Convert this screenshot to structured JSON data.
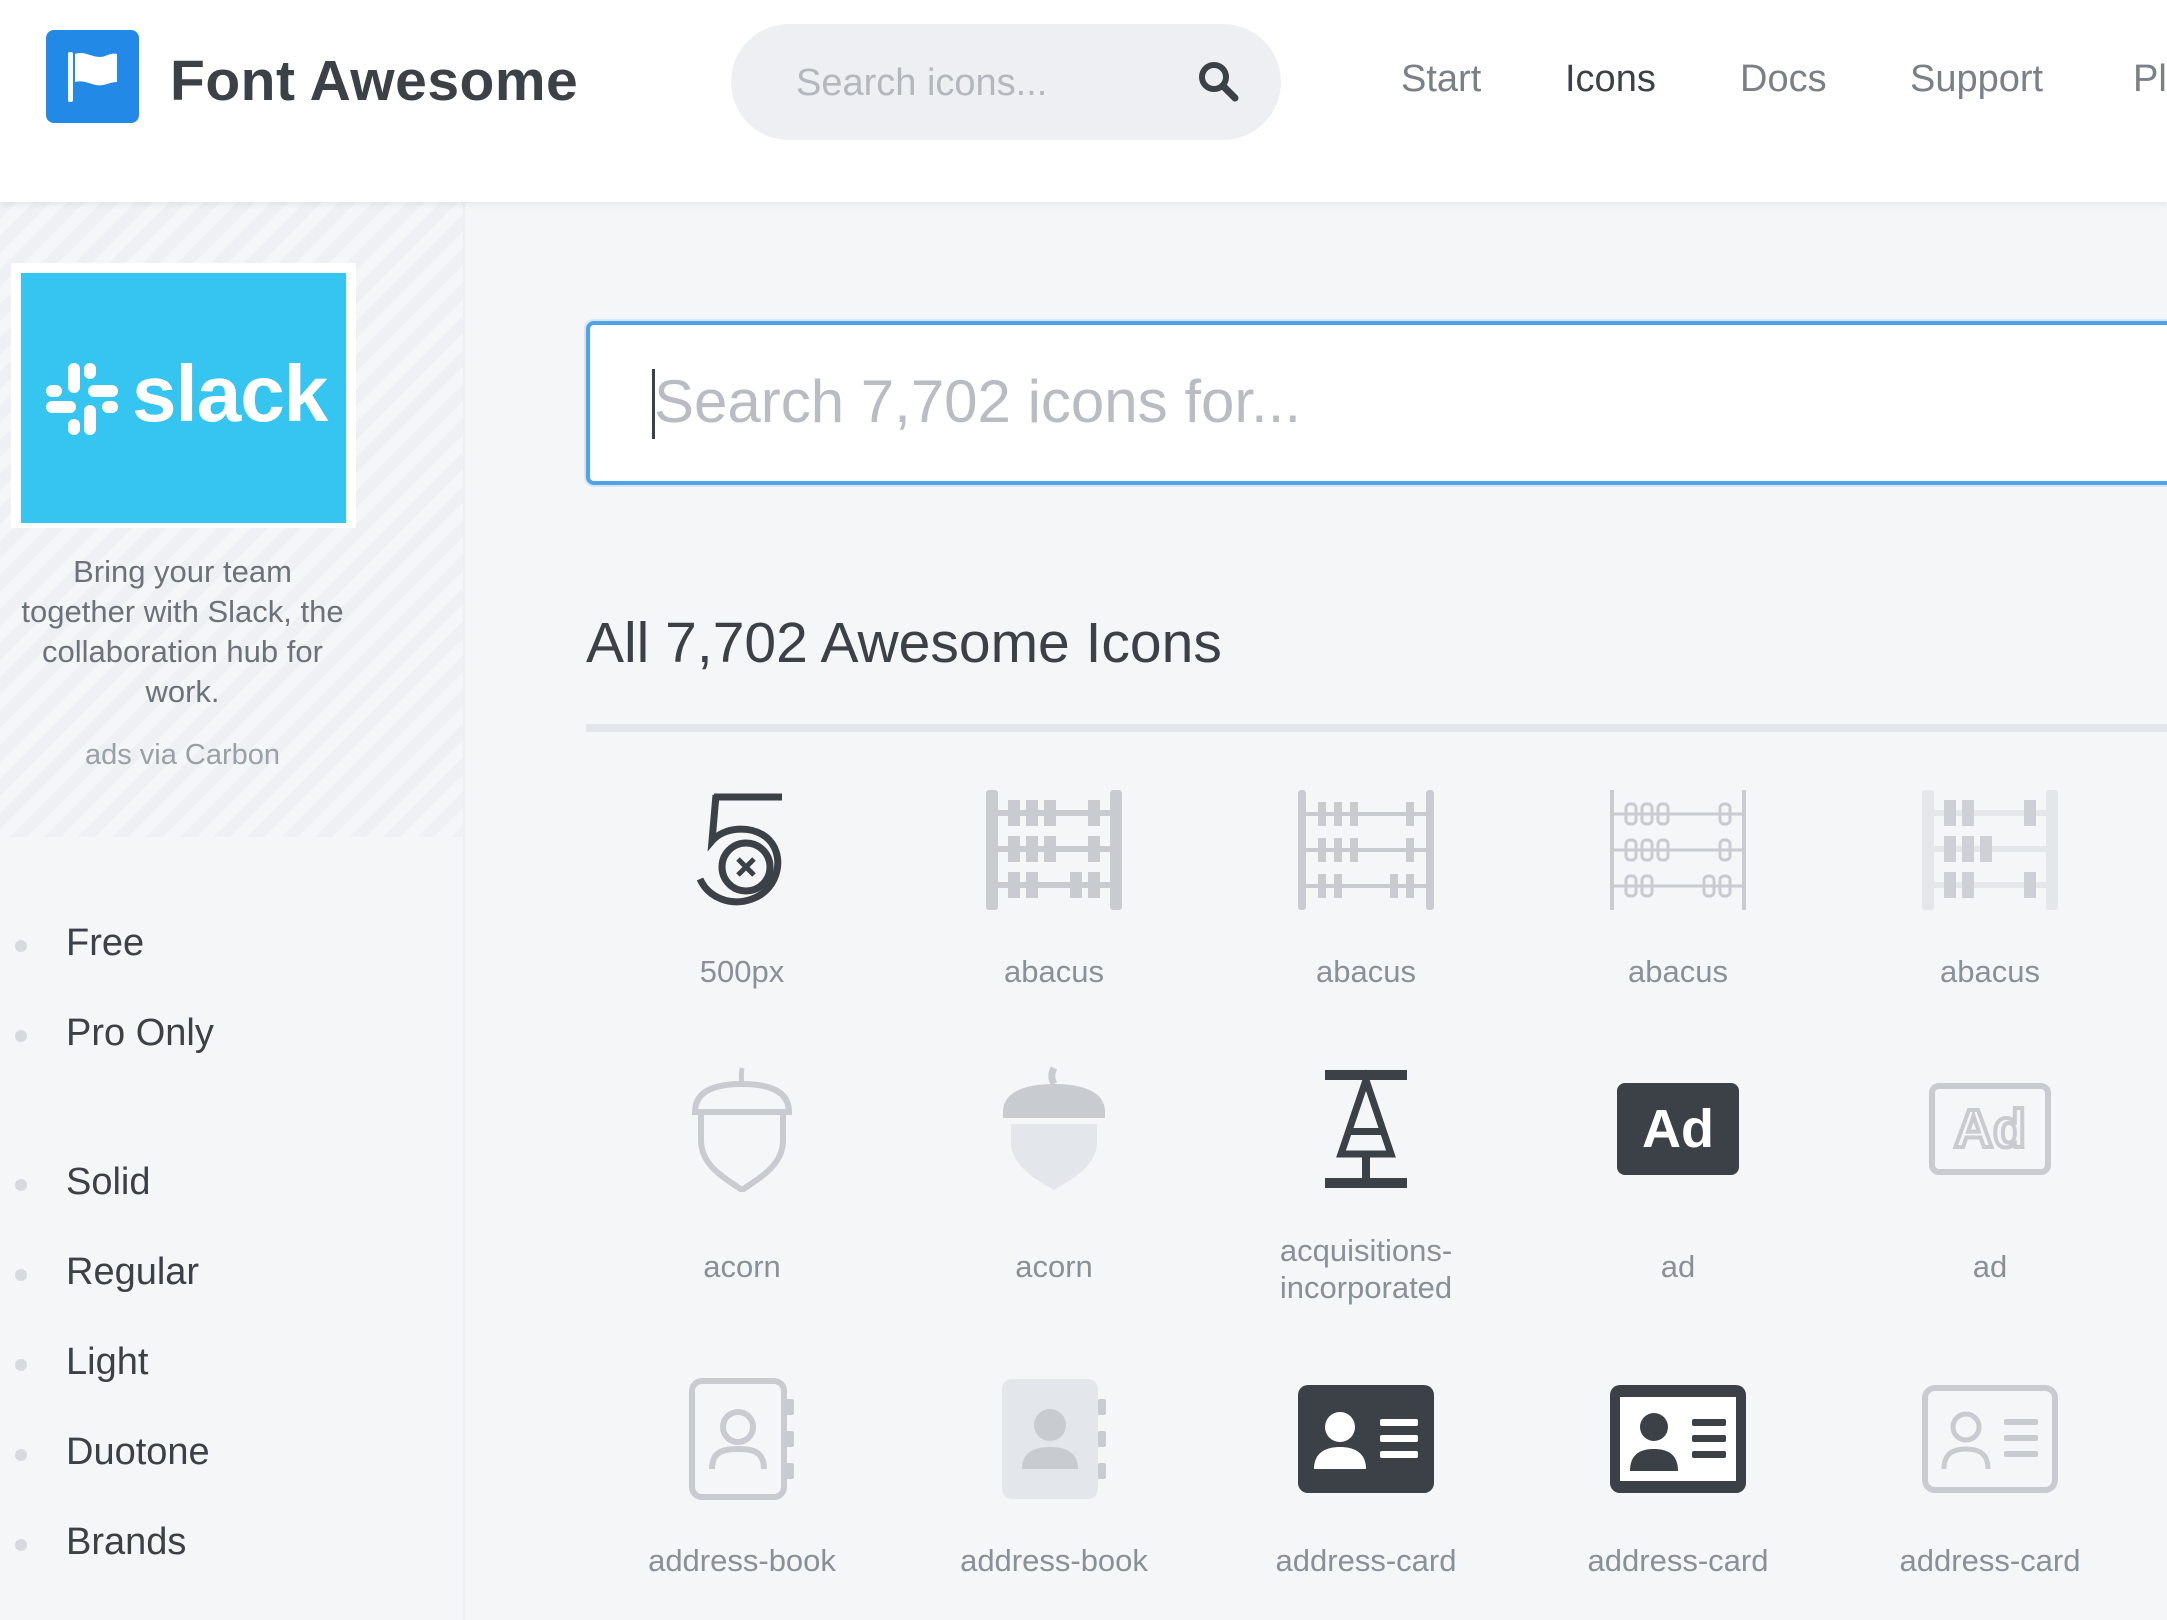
{
  "header": {
    "brand": "Font Awesome",
    "search_placeholder": "Search icons...",
    "nav": [
      "Start",
      "Icons",
      "Docs",
      "Support",
      "Pl"
    ],
    "active_nav": "Icons"
  },
  "sidebar": {
    "ad": {
      "image_text": "slack",
      "text": "Bring your team together with Slack, the collaboration hub for work.",
      "via": "ads via Carbon"
    },
    "license_filters": [
      "Free",
      "Pro Only"
    ],
    "style_filters": [
      "Solid",
      "Regular",
      "Light",
      "Duotone",
      "Brands"
    ]
  },
  "main": {
    "search_placeholder": "Search 7,702 icons for...",
    "heading": "All 7,702 Awesome Icons",
    "icons": [
      {
        "label": "500px",
        "icon": "500px-icon"
      },
      {
        "label": "abacus",
        "icon": "abacus-icon"
      },
      {
        "label": "abacus",
        "icon": "abacus-icon"
      },
      {
        "label": "abacus",
        "icon": "abacus-icon"
      },
      {
        "label": "abacus",
        "icon": "abacus-icon"
      },
      {
        "label": "acorn",
        "icon": "acorn-icon"
      },
      {
        "label": "acorn",
        "icon": "acorn-icon"
      },
      {
        "label": "acquisitions-incorporated",
        "icon": "acquisitions-incorporated-icon"
      },
      {
        "label": "ad",
        "icon": "ad-icon"
      },
      {
        "label": "ad",
        "icon": "ad-icon"
      },
      {
        "label": "address-book",
        "icon": "address-book-icon"
      },
      {
        "label": "address-book",
        "icon": "address-book-icon"
      },
      {
        "label": "address-card",
        "icon": "address-card-icon"
      },
      {
        "label": "address-card",
        "icon": "address-card-icon"
      },
      {
        "label": "address-card",
        "icon": "address-card-icon"
      }
    ]
  },
  "colors": {
    "accent": "#228ae6",
    "icon_dark": "#3c4047",
    "icon_light": "#c8ccd1",
    "slack": "#36c5f0"
  }
}
